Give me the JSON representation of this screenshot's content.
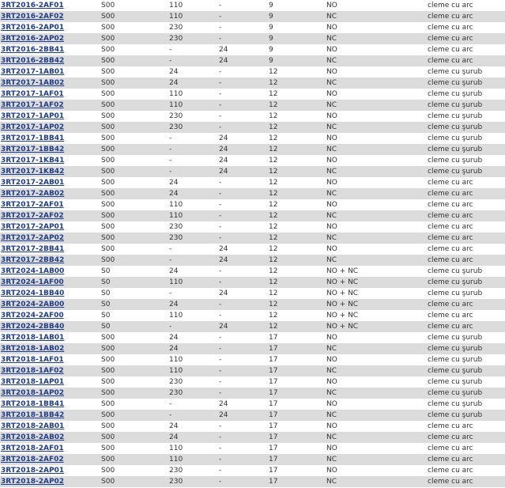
{
  "table": {
    "rows": [
      [
        "3RT2016-2AF01",
        "S00",
        "110",
        "-",
        "9",
        "NO",
        "cleme cu arc"
      ],
      [
        "3RT2016-2AF02",
        "S00",
        "110",
        "-",
        "9",
        "NC",
        "cleme cu arc"
      ],
      [
        "3RT2016-2AP01",
        "S00",
        "230",
        "-",
        "9",
        "NO",
        "cleme cu arc"
      ],
      [
        "3RT2016-2AP02",
        "S00",
        "230",
        "-",
        "9",
        "NC",
        "cleme cu arc"
      ],
      [
        "3RT2016-2BB41",
        "S00",
        "-",
        "24",
        "9",
        "NO",
        "cleme cu arc"
      ],
      [
        "3RT2016-2BB42",
        "S00",
        "-",
        "24",
        "9",
        "NC",
        "cleme cu arc"
      ],
      [
        "3RT2017-1AB01",
        "S00",
        "24",
        "-",
        "12",
        "NO",
        "cleme cu şurub"
      ],
      [
        "3RT2017-1AB02",
        "S00",
        "24",
        "-",
        "12",
        "NC",
        "cleme cu şurub"
      ],
      [
        "3RT2017-1AF01",
        "S00",
        "110",
        "-",
        "12",
        "NO",
        "cleme cu şurub"
      ],
      [
        "3RT2017-1AF02",
        "S00",
        "110",
        "-",
        "12",
        "NC",
        "cleme cu şurub"
      ],
      [
        "3RT2017-1AP01",
        "S00",
        "230",
        "-",
        "12",
        "NO",
        "cleme cu şurub"
      ],
      [
        "3RT2017-1AP02",
        "S00",
        "230",
        "-",
        "12",
        "NC",
        "cleme cu şurub"
      ],
      [
        "3RT2017-1BB41",
        "S00",
        "-",
        "24",
        "12",
        "NO",
        "cleme cu şurub"
      ],
      [
        "3RT2017-1BB42",
        "S00",
        "-",
        "24",
        "12",
        "NC",
        "cleme cu şurub"
      ],
      [
        "3RT2017-1KB41",
        "S00",
        "-",
        "24",
        "12",
        "NO",
        "cleme cu şurub"
      ],
      [
        "3RT2017-1KB42",
        "S00",
        "-",
        "24",
        "12",
        "NC",
        "cleme cu şurub"
      ],
      [
        "3RT2017-2AB01",
        "S00",
        "24",
        "-",
        "12",
        "NO",
        "cleme cu arc"
      ],
      [
        "3RT2017-2AB02",
        "S00",
        "24",
        "-",
        "12",
        "NC",
        "cleme cu arc"
      ],
      [
        "3RT2017-2AF01",
        "S00",
        "110",
        "-",
        "12",
        "NO",
        "cleme cu arc"
      ],
      [
        "3RT2017-2AF02",
        "S00",
        "110",
        "-",
        "12",
        "NC",
        "cleme cu arc"
      ],
      [
        "3RT2017-2AP01",
        "S00",
        "230",
        "-",
        "12",
        "NO",
        "cleme cu arc"
      ],
      [
        "3RT2017-2AP02",
        "S00",
        "230",
        "-",
        "12",
        "NC",
        "cleme cu arc"
      ],
      [
        "3RT2017-2BB41",
        "S00",
        "-",
        "24",
        "12",
        "NO",
        "cleme cu arc"
      ],
      [
        "3RT2017-2BB42",
        "S00",
        "-",
        "24",
        "12",
        "NC",
        "cleme cu arc"
      ],
      [
        "3RT2024-1AB00",
        "S0",
        "24",
        "-",
        "12",
        "NO + NC",
        "cleme cu şurub"
      ],
      [
        "3RT2024-1AF00",
        "S0",
        "110",
        "-",
        "12",
        "NO + NC",
        "cleme cu şurub"
      ],
      [
        "3RT2024-1BB40",
        "S0",
        "-",
        "24",
        "12",
        "NO + NC",
        "cleme cu şurub"
      ],
      [
        "3RT2024-2AB00",
        "S0",
        "24",
        "-",
        "12",
        "NO + NC",
        "cleme cu arc"
      ],
      [
        "3RT2024-2AF00",
        "S0",
        "110",
        "-",
        "12",
        "NO + NC",
        "cleme cu arc"
      ],
      [
        "3RT2024-2BB40",
        "S0",
        "-",
        "24",
        "12",
        "NO + NC",
        "cleme cu arc"
      ],
      [
        "3RT2018-1AB01",
        "S00",
        "24",
        "-",
        "17",
        "NO",
        "cleme cu şurub"
      ],
      [
        "3RT2018-1AB02",
        "S00",
        "24",
        "-",
        "17",
        "NC",
        "cleme cu şurub"
      ],
      [
        "3RT2018-1AF01",
        "S00",
        "110",
        "-",
        "17",
        "NO",
        "cleme cu şurub"
      ],
      [
        "3RT2018-1AF02",
        "S00",
        "110",
        "-",
        "17",
        "NC",
        "cleme cu şurub"
      ],
      [
        "3RT2018-1AP01",
        "S00",
        "230",
        "-",
        "17",
        "NO",
        "cleme cu şurub"
      ],
      [
        "3RT2018-1AP02",
        "S00",
        "230",
        "-",
        "17",
        "NC",
        "cleme cu şurub"
      ],
      [
        "3RT2018-1BB41",
        "S00",
        "-",
        "24",
        "17",
        "NO",
        "cleme cu şurub"
      ],
      [
        "3RT2018-1BB42",
        "S00",
        "-",
        "24",
        "17",
        "NC",
        "cleme cu şurub"
      ],
      [
        "3RT2018-2AB01",
        "S00",
        "24",
        "-",
        "17",
        "NO",
        "cleme cu arc"
      ],
      [
        "3RT2018-2AB02",
        "S00",
        "24",
        "-",
        "17",
        "NC",
        "cleme cu arc"
      ],
      [
        "3RT2018-2AF01",
        "S00",
        "110",
        "-",
        "17",
        "NO",
        "cleme cu arc"
      ],
      [
        "3RT2018-2AF02",
        "S00",
        "110",
        "-",
        "17",
        "NC",
        "cleme cu arc"
      ],
      [
        "3RT2018-2AP01",
        "S00",
        "230",
        "-",
        "17",
        "NO",
        "cleme cu arc"
      ],
      [
        "3RT2018-2AP02",
        "S00",
        "230",
        "-",
        "17",
        "NC",
        "cleme cu arc"
      ]
    ]
  }
}
